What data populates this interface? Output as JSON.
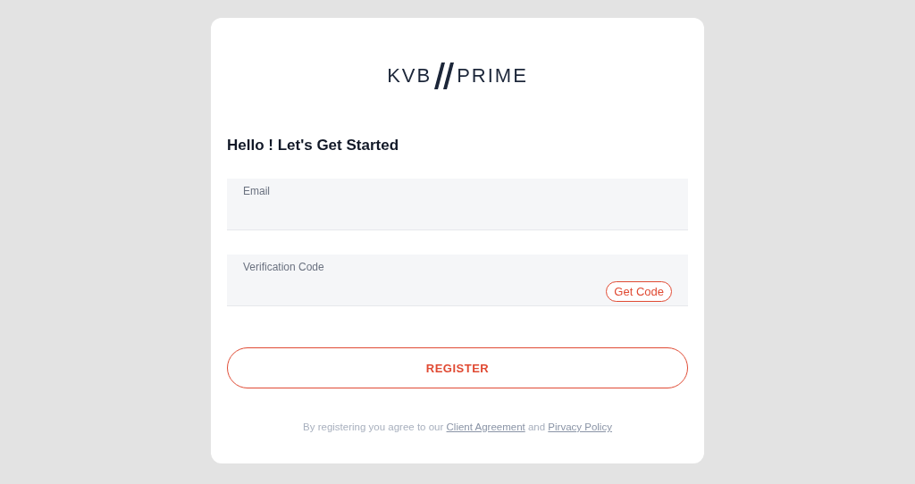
{
  "logo": {
    "left": "KVB",
    "right": "PRIME"
  },
  "heading": "Hello ! Let's Get Started",
  "fields": [
    {
      "kind": "text",
      "label": "Email"
    },
    {
      "kind": "code",
      "label": "Verification Code",
      "action": "Get Code"
    }
  ],
  "register_button": "REGISTER",
  "terms": {
    "before": "By registering you agree to our ",
    "link1": "Client Agreement",
    "middle": " and ",
    "link2": "Pirvacy Policy"
  }
}
